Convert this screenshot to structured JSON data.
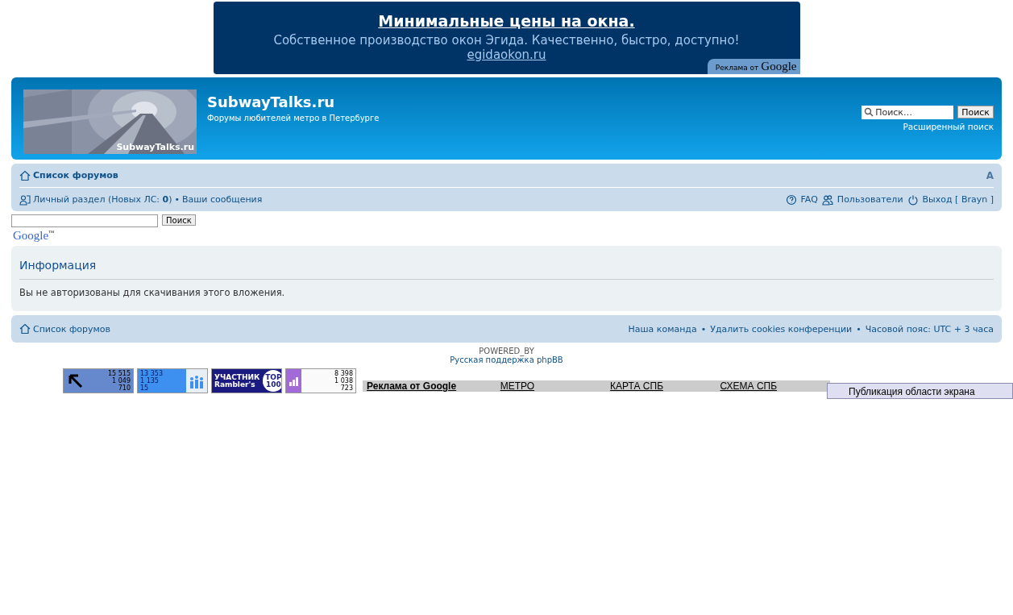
{
  "ad_banner": {
    "headline": "Минимальные цены на окна.",
    "text": "Собственное производство окон Эгида. Качественно, быстро, доступно!",
    "url": "egidaokon.ru",
    "badge_prefix": "Реклама от",
    "badge_brand": "Google"
  },
  "header": {
    "site_title": "SubwayTalks.ru",
    "site_description": "Форумы любителей метро в Петербурге",
    "logo_caption": "SubwayTalks.ru",
    "search_placeholder": "Поиск…",
    "search_button": "Поиск",
    "advanced_search": "Расширенный поиск"
  },
  "navbar": {
    "breadcrumb": "Список форумов",
    "font_size_control": "A",
    "personal": {
      "label": "Личный раздел (Новых ЛС: ",
      "count": "0",
      "suffix": ")"
    },
    "separator": "•",
    "your_posts": "Ваши сообщения",
    "right_links": [
      {
        "kind": "faq",
        "label": "FAQ"
      },
      {
        "kind": "members",
        "label": "Пользователи"
      },
      {
        "kind": "logout",
        "label": "Выход [ Brayn ]"
      }
    ]
  },
  "google_search": {
    "button": "Поиск",
    "logo": "Google",
    "tm": "™"
  },
  "info_panel": {
    "title": "Информация",
    "message": "Вы не авторизованы для скачивания этого вложения."
  },
  "footer_nav": {
    "breadcrumb": "Список форумов",
    "links": [
      "Наша команда",
      "Удалить cookies конференции"
    ],
    "separator": "•",
    "timezone": "Часовой пояс: UTC + 3 часа"
  },
  "copyright": {
    "powered_by": "POWERED_BY",
    "support": "Русская поддержка phpBB"
  },
  "counters": [
    {
      "kind": "liveinternet",
      "values": [
        "15 515",
        "1 049",
        "710"
      ]
    },
    {
      "kind": "people",
      "values": [
        "13 353",
        "1 135",
        "15"
      ]
    },
    {
      "kind": "rambler",
      "values": [
        "УЧАСТНИК",
        "Rambler's",
        "TOP",
        "100"
      ]
    },
    {
      "kind": "stats",
      "values": [
        "8 398",
        "1 038",
        "723"
      ]
    }
  ],
  "link_bar": [
    {
      "label": "Реклама от Google",
      "bold": true
    },
    {
      "label": "МЕТРО",
      "bold": false
    },
    {
      "label": "КАРТА СПБ",
      "bold": false
    },
    {
      "label": "СХЕМА СПБ",
      "bold": false
    }
  ],
  "overlay_tooltip": "Публикация области экрана"
}
